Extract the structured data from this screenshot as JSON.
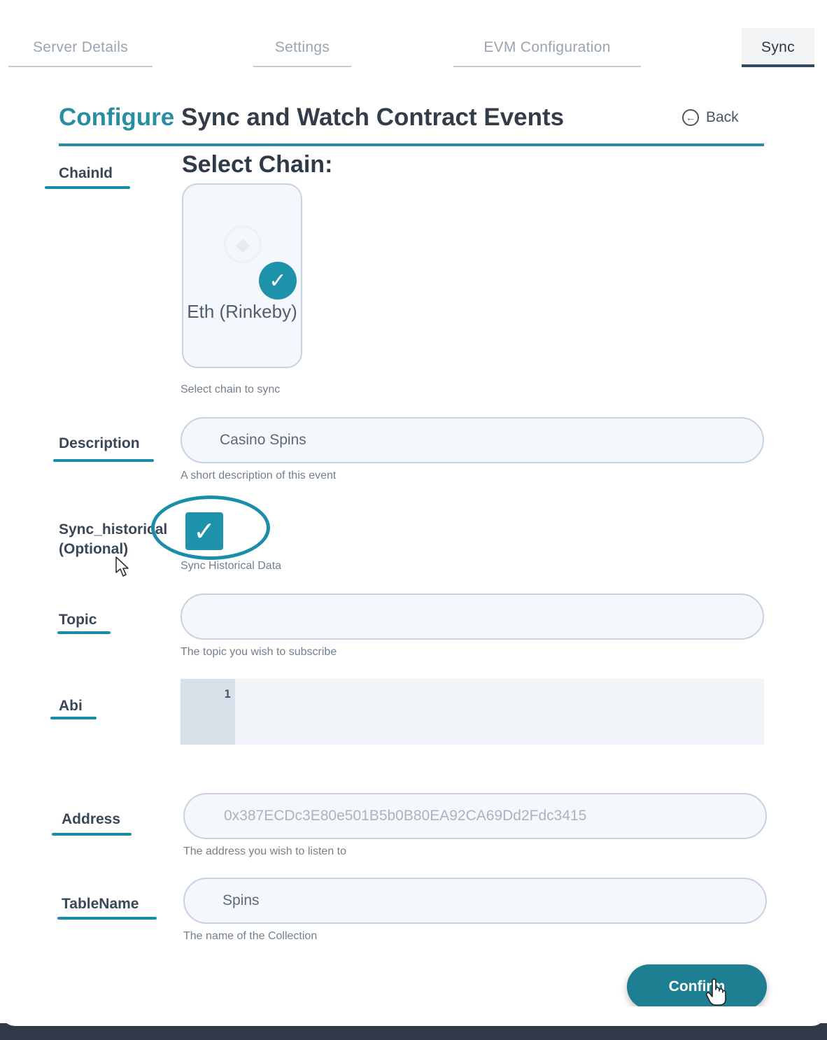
{
  "tabs": [
    {
      "label": "Server Details",
      "active": false
    },
    {
      "label": "Settings",
      "active": false
    },
    {
      "label": "EVM Configuration",
      "active": false
    },
    {
      "label": "Sync",
      "active": true
    }
  ],
  "header": {
    "title_accent": "Configure",
    "title_rest": "Sync and Watch Contract Events",
    "back_label": "Back",
    "accent_color": "#2a8ea2"
  },
  "form": {
    "chainid": {
      "label": "ChainId",
      "section_title": "Select Chain:",
      "chain_name": "Eth (Rinkeby)",
      "selected": true,
      "helper": "Select chain to sync"
    },
    "description": {
      "label": "Description",
      "value": "Casino Spins",
      "helper": "A short description of this event"
    },
    "sync_historical": {
      "label_line1": "Sync_historical",
      "label_line2": "(Optional)",
      "checked": true,
      "helper": "Sync Historical Data"
    },
    "topic": {
      "label": "Topic",
      "value": "",
      "helper": "The topic you wish to subscribe"
    },
    "abi": {
      "label": "Abi",
      "line_number": "1"
    },
    "address": {
      "label": "Address",
      "placeholder": "0x387ECDc3E80e501B5b0B80EA92CA69Dd2Fdc3415",
      "helper": "The address you wish to listen to"
    },
    "tablename": {
      "label": "TableName",
      "value": "Spins",
      "helper": "The name of the Collection"
    }
  },
  "confirm_label": "Confirm"
}
